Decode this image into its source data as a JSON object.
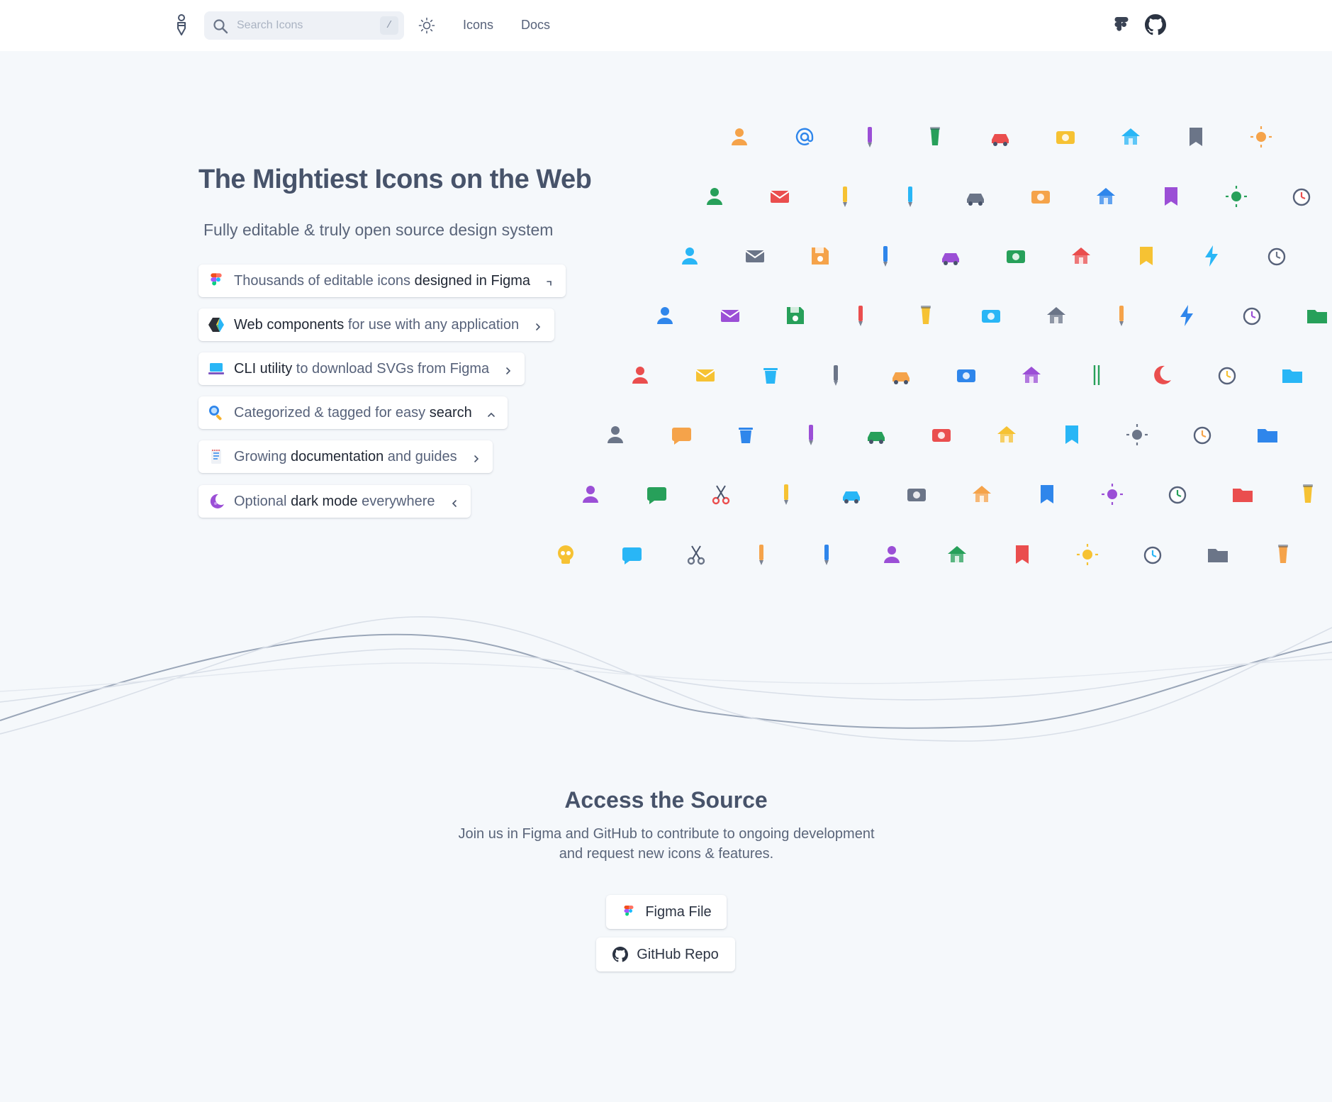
{
  "header": {
    "search_placeholder": "Search Icons",
    "search_shortcut": "/",
    "nav": {
      "icons": "Icons",
      "docs": "Docs"
    }
  },
  "hero": {
    "title": "The Mightiest Icons on the Web",
    "subtitle": "Fully editable & truly open source design system",
    "features": [
      {
        "icon": "figma-icon",
        "parts": [
          [
            "Thousands of editable icons ",
            false
          ],
          [
            "designed in Figma",
            true
          ]
        ],
        "chevron": "external"
      },
      {
        "icon": "webcomponents-icon",
        "parts": [
          [
            "Web components",
            true
          ],
          [
            " for use with any application",
            false
          ]
        ],
        "chevron": "right"
      },
      {
        "icon": "laptop-icon",
        "parts": [
          [
            "CLI utility",
            true
          ],
          [
            " to download SVGs from Figma",
            false
          ]
        ],
        "chevron": "right"
      },
      {
        "icon": "search-icon",
        "parts": [
          [
            "Categorized & tagged for easy ",
            false
          ],
          [
            "search",
            true
          ]
        ],
        "chevron": "up"
      },
      {
        "icon": "document-icon",
        "parts": [
          [
            "Growing ",
            false
          ],
          [
            "documentation",
            true
          ],
          [
            " and guides",
            false
          ]
        ],
        "chevron": "right"
      },
      {
        "icon": "moon-icon",
        "parts": [
          [
            "Optional ",
            false
          ],
          [
            "dark mode",
            true
          ],
          [
            " everywhere",
            false
          ]
        ],
        "chevron": "left"
      }
    ]
  },
  "access": {
    "title": "Access the Source",
    "text_line1": "Join us in Figma and GitHub to contribute to ongoing development",
    "text_line2": "and request new icons & features.",
    "figma_button": "Figma File",
    "github_button": "GitHub Repo"
  },
  "colors": {
    "background": "#f5f8fb",
    "text": "#47536a",
    "orange": "#f5a34a",
    "blue": "#2f86eb",
    "purple": "#9b4fd6",
    "green": "#27a05a",
    "red": "#ea4e4e",
    "yellow": "#f6c233"
  },
  "icon_field": [
    [
      "person-icon",
      "at-sign-icon",
      "edit-icon",
      "cup-icon",
      "bicycle-icon",
      "camera-icon",
      "home-icon",
      "bookmark-icon",
      "fahrenheit-icon",
      "clock-icon"
    ],
    [
      "users-icon",
      "card-icon",
      "pencil-square-icon",
      "pen-nib-icon",
      "scooter-icon",
      "camera-alt-icon",
      "house-icon",
      "bookmark-alt-icon",
      "celsius-icon",
      "clock-alt-icon"
    ],
    [
      "users-alt-icon",
      "mail-icon",
      "floppy-icon",
      "brush-icon",
      "scooter-alt-icon",
      "camera-lens-icon",
      "house-drop-icon",
      "book-open-icon",
      "lightning-icon",
      "clock-fast-icon",
      "box-icon"
    ],
    [
      "user-circle-icon",
      "mail-open-icon",
      "save-icon",
      "signature-icon",
      "lamp-icon",
      "video-icon",
      "house-fire-icon",
      "pencil-thin-icon",
      "bolt-icon",
      "alarm-icon",
      "inbox-icon"
    ],
    [
      "user-chat-icon",
      "newsletter-icon",
      "trash-icon",
      "crayon-icon",
      "delivery-icon",
      "video-alt-icon",
      "house-flood-icon",
      "chopsticks-icon",
      "moon-icon",
      "alarm-alert-icon",
      "inbox-alt-icon"
    ],
    [
      "agent-icon",
      "chat-bubble-icon",
      "trash-alt-icon",
      "pencil-icon",
      "car-icon",
      "film-icon",
      "garage-icon",
      "books-icon",
      "sun-icon",
      "alarm-add-icon",
      "folder-icon",
      "puzzle-icon"
    ],
    [
      "head-icon",
      "chat-round-icon",
      "scissors-icon",
      "pencil-alt-icon",
      "car-wash-icon",
      "film-alt-icon",
      "barn-icon",
      "book-icon",
      "sun-alt-icon",
      "alarm-minus-icon",
      "folder-alt-icon",
      "hospital-sign-icon"
    ],
    [
      "skull-icon",
      "chat-square-icon",
      "scissors-alt-icon",
      "pen-icon",
      "eraser-icon",
      "headphones-icon",
      "bank-icon",
      "passport-icon",
      "sunrise-icon",
      "alarm-snooze-icon",
      "folder-open-icon",
      "medical-icon"
    ]
  ]
}
